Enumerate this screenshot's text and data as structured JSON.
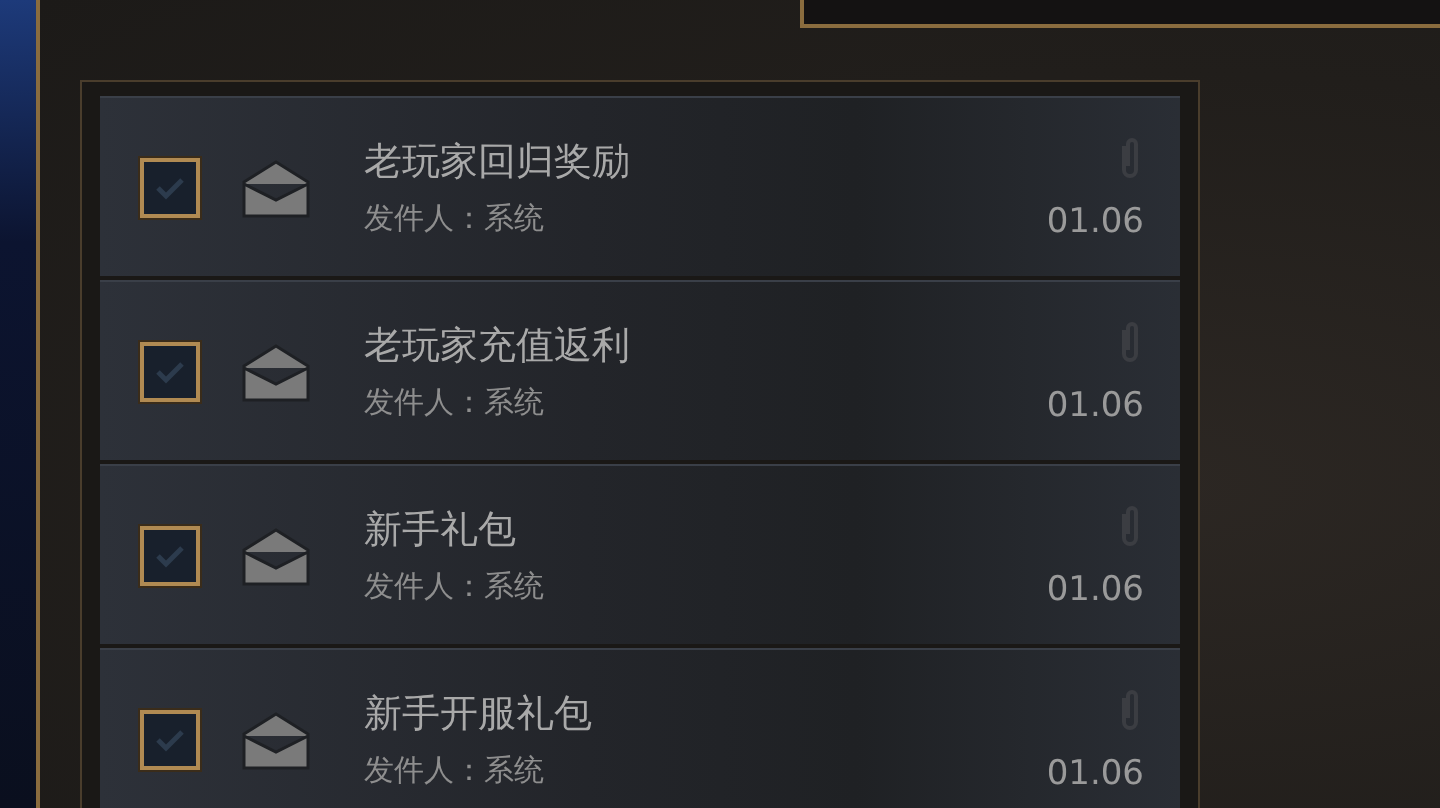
{
  "mails": [
    {
      "title": "老玩家回归奖励",
      "sender": "发件人：系统",
      "date": "01.06",
      "checked": true
    },
    {
      "title": "老玩家充值返利",
      "sender": "发件人：系统",
      "date": "01.06",
      "checked": true
    },
    {
      "title": "新手礼包",
      "sender": "发件人：系统",
      "date": "01.06",
      "checked": true
    },
    {
      "title": "新手开服礼包",
      "sender": "发件人：系统",
      "date": "01.06",
      "checked": true
    }
  ]
}
